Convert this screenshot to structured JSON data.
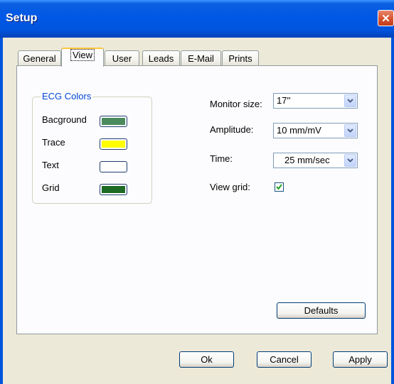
{
  "window": {
    "title": "Setup"
  },
  "tabs": [
    {
      "label": "General"
    },
    {
      "label": "View",
      "active": true
    },
    {
      "label": "User"
    },
    {
      "label": "Leads"
    },
    {
      "label": "E-Mail"
    },
    {
      "label": "Prints"
    }
  ],
  "ecg_colors": {
    "title": "ECG Colors",
    "items": [
      {
        "label": "Bacground",
        "color": "#4a8a5c"
      },
      {
        "label": "Trace",
        "color": "#ffff00"
      },
      {
        "label": "Text",
        "color": "#ffffff"
      },
      {
        "label": "Grid",
        "color": "#1d6a25"
      }
    ]
  },
  "settings": {
    "monitor_size": {
      "label": "Monitor size:",
      "value": "17''"
    },
    "amplitude": {
      "label": "Amplitude:",
      "value": "10 mm/mV"
    },
    "time": {
      "label": "Time:",
      "value": "25  mm/sec"
    },
    "view_grid": {
      "label": "View grid:",
      "checked": true
    }
  },
  "buttons": {
    "defaults": "Defaults",
    "ok": "Ok",
    "cancel": "Cancel",
    "apply": "Apply"
  },
  "icons": {
    "close": "close-icon",
    "dropdown": "chevron-down-icon",
    "check": "checkmark-icon"
  }
}
